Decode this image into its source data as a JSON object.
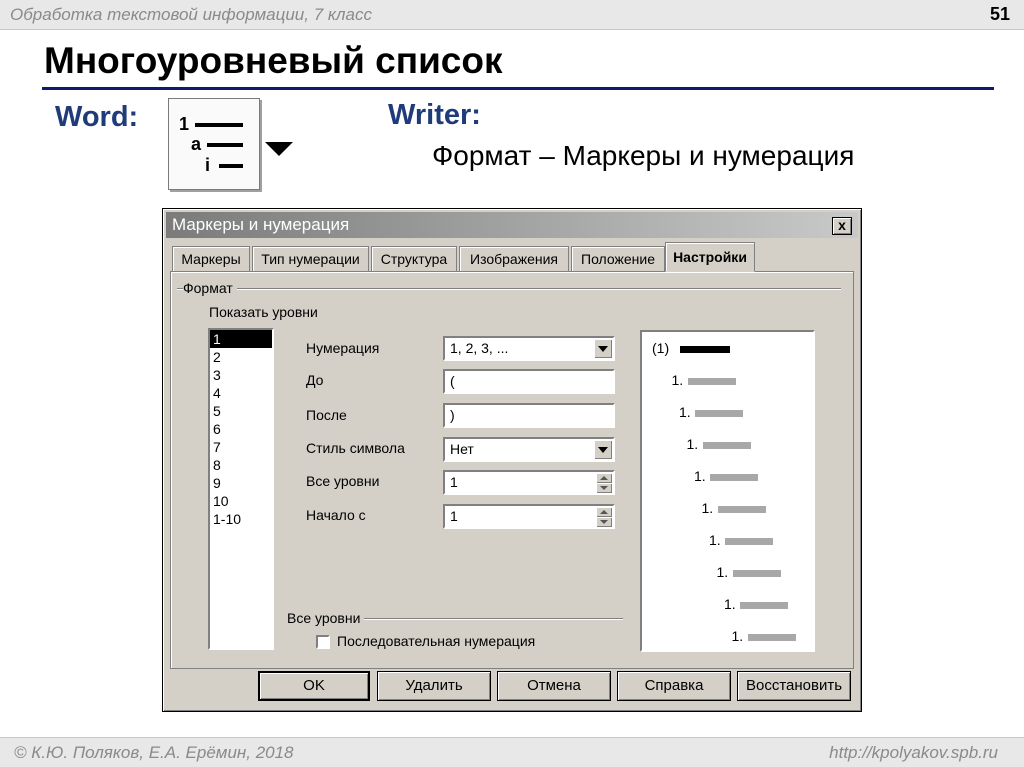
{
  "slide": {
    "subtitle": "Обработка текстовой информации, 7 класс",
    "number": "51",
    "title": "Многоуровневый список",
    "word_label": "Word:",
    "writer_label": "Writer:",
    "writer_path": "Формат – Маркеры и нумерация",
    "footer_left": "© К.Ю. Поляков, Е.А. Ерёмин, 2018",
    "footer_right": "http://kpolyakov.spb.ru"
  },
  "word_button": {
    "icon": "multilevel-list-icon",
    "rows": [
      "1",
      "a",
      "i"
    ]
  },
  "dialog": {
    "title": "Маркеры и нумерация",
    "close_label": "x",
    "tabs": [
      {
        "label": "Маркеры",
        "active": false
      },
      {
        "label": "Тип нумерации",
        "active": false
      },
      {
        "label": "Структура",
        "active": false
      },
      {
        "label": "Изображения",
        "active": false
      },
      {
        "label": "Положение",
        "active": false
      },
      {
        "label": "Настройки",
        "active": true
      }
    ],
    "format_group": "Формат",
    "show_levels_label": "Показать уровни",
    "levels": [
      "1",
      "2",
      "3",
      "4",
      "5",
      "6",
      "7",
      "8",
      "9",
      "10",
      "1-10"
    ],
    "selected_level": "1",
    "fields": {
      "numbering": {
        "label": "Нумерация",
        "value": "1, 2, 3, ..."
      },
      "before": {
        "label": "До",
        "value": "("
      },
      "after": {
        "label": "После",
        "value": ")"
      },
      "char_style": {
        "label": "Стиль символа",
        "value": "Нет"
      },
      "all_levels": {
        "label": "Все уровни",
        "value": "1"
      },
      "start_at": {
        "label": "Начало с",
        "value": "1"
      }
    },
    "all_levels_group": "Все уровни",
    "consecutive_label": "Последовательная нумерация",
    "consecutive_checked": false,
    "preview": [
      "(1)",
      "1.",
      "1.",
      "1.",
      "1.",
      "1.",
      "1.",
      "1.",
      "1.",
      "1."
    ],
    "preview_colors": {
      "active": "#000000",
      "inactive": "#a8a8a8"
    },
    "buttons": {
      "ok": "OK",
      "delete": "Удалить",
      "cancel": "Отмена",
      "help": "Справка",
      "reset": "Восстановить"
    }
  }
}
